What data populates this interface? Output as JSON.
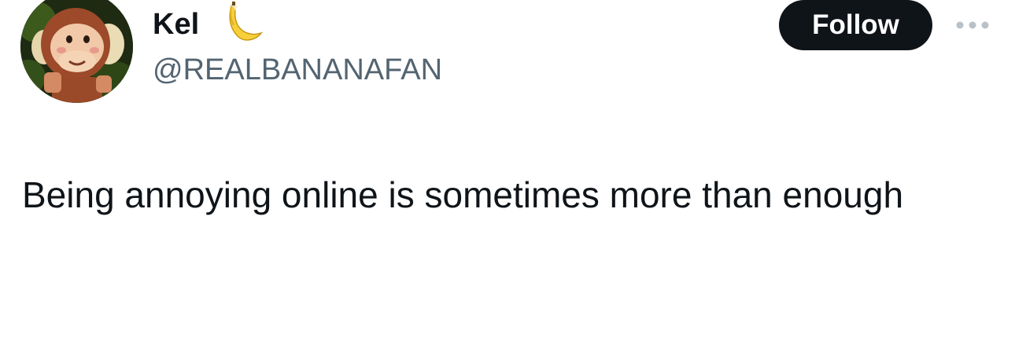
{
  "tweet": {
    "author": {
      "display_name": "Kel",
      "name_emoji": "banana-icon",
      "handle": "@REALBANANAFAN",
      "avatar": "monkey-avatar"
    },
    "follow_label": "Follow",
    "more_icon": "ellipsis-icon",
    "text": "Being annoying online is sometimes more than enough"
  },
  "colors": {
    "text_primary": "#0f1419",
    "text_secondary": "#536471",
    "follow_bg": "#0f1419",
    "follow_text": "#ffffff",
    "more_icon": "#b9c1c8"
  }
}
